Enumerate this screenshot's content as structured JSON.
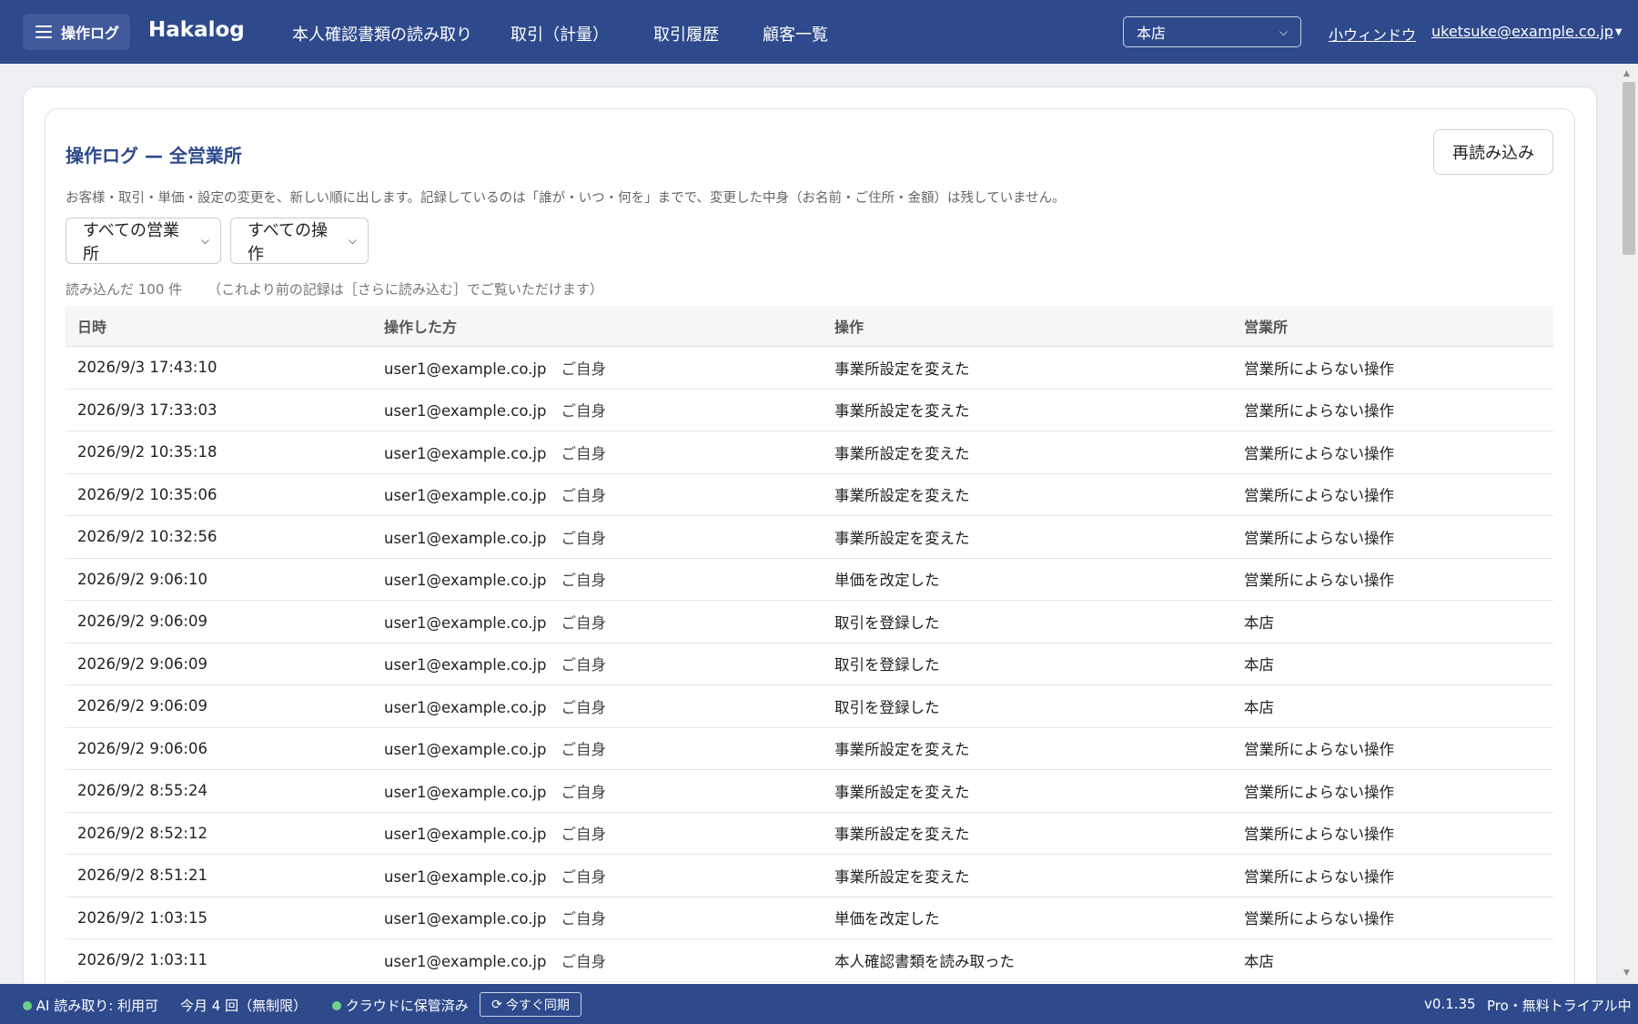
{
  "header": {
    "menu_label": "操作ログ",
    "brand": "Hakalog",
    "nav": [
      "本人確認書類の読み取り",
      "取引（計量）",
      "取引履歴",
      "顧客一覧"
    ],
    "store_selected": "本店",
    "small_window": "小ウィンドウ",
    "user": "uketsuke@example.co.jp"
  },
  "main": {
    "title": "操作ログ — 全営業所",
    "reload": "再読み込み",
    "description": "お客様・取引・単価・設定の変更を、新しい順に出します。記録しているのは「誰が・いつ・何を」までで、変更した中身（お名前・ご住所・金額）は残していません。",
    "filter_office": "すべての営業所",
    "filter_action": "すべての操作",
    "count": "読み込んだ 100 件",
    "count_note": "（これより前の記録は［さらに読み込む］でご覧いただけます）"
  },
  "table": {
    "headers": [
      "日時",
      "操作した方",
      "操作",
      "営業所"
    ],
    "rows": [
      {
        "time": "2026/9/3 17:43:10",
        "user": "user1@example.co.jp",
        "self": "ご自身",
        "action": "事業所設定を変えた",
        "office": "営業所によらない操作"
      },
      {
        "time": "2026/9/3 17:33:03",
        "user": "user1@example.co.jp",
        "self": "ご自身",
        "action": "事業所設定を変えた",
        "office": "営業所によらない操作"
      },
      {
        "time": "2026/9/2 10:35:18",
        "user": "user1@example.co.jp",
        "self": "ご自身",
        "action": "事業所設定を変えた",
        "office": "営業所によらない操作"
      },
      {
        "time": "2026/9/2 10:35:06",
        "user": "user1@example.co.jp",
        "self": "ご自身",
        "action": "事業所設定を変えた",
        "office": "営業所によらない操作"
      },
      {
        "time": "2026/9/2 10:32:56",
        "user": "user1@example.co.jp",
        "self": "ご自身",
        "action": "事業所設定を変えた",
        "office": "営業所によらない操作"
      },
      {
        "time": "2026/9/2 9:06:10",
        "user": "user1@example.co.jp",
        "self": "ご自身",
        "action": "単価を改定した",
        "office": "営業所によらない操作"
      },
      {
        "time": "2026/9/2 9:06:09",
        "user": "user1@example.co.jp",
        "self": "ご自身",
        "action": "取引を登録した",
        "office": "本店"
      },
      {
        "time": "2026/9/2 9:06:09",
        "user": "user1@example.co.jp",
        "self": "ご自身",
        "action": "取引を登録した",
        "office": "本店"
      },
      {
        "time": "2026/9/2 9:06:09",
        "user": "user1@example.co.jp",
        "self": "ご自身",
        "action": "取引を登録した",
        "office": "本店"
      },
      {
        "time": "2026/9/2 9:06:06",
        "user": "user1@example.co.jp",
        "self": "ご自身",
        "action": "事業所設定を変えた",
        "office": "営業所によらない操作"
      },
      {
        "time": "2026/9/2 8:55:24",
        "user": "user1@example.co.jp",
        "self": "ご自身",
        "action": "事業所設定を変えた",
        "office": "営業所によらない操作"
      },
      {
        "time": "2026/9/2 8:52:12",
        "user": "user1@example.co.jp",
        "self": "ご自身",
        "action": "事業所設定を変えた",
        "office": "営業所によらない操作"
      },
      {
        "time": "2026/9/2 8:51:21",
        "user": "user1@example.co.jp",
        "self": "ご自身",
        "action": "事業所設定を変えた",
        "office": "営業所によらない操作"
      },
      {
        "time": "2026/9/2 1:03:15",
        "user": "user1@example.co.jp",
        "self": "ご自身",
        "action": "単価を改定した",
        "office": "営業所によらない操作"
      },
      {
        "time": "2026/9/2 1:03:11",
        "user": "user1@example.co.jp",
        "self": "ご自身",
        "action": "本人確認書類を読み取った",
        "office": "本店"
      }
    ]
  },
  "footer": {
    "ai_status": "AI 読み取り: 利用可",
    "usage": "今月 4 回（無制限）",
    "cloud": "クラウドに保管済み",
    "sync": "今すぐ同期",
    "version": "v0.1.35",
    "plan": "Pro・無料トライアル中"
  },
  "colors": {
    "header": "#2e4a8c",
    "status_dot": "#6fd08a"
  }
}
